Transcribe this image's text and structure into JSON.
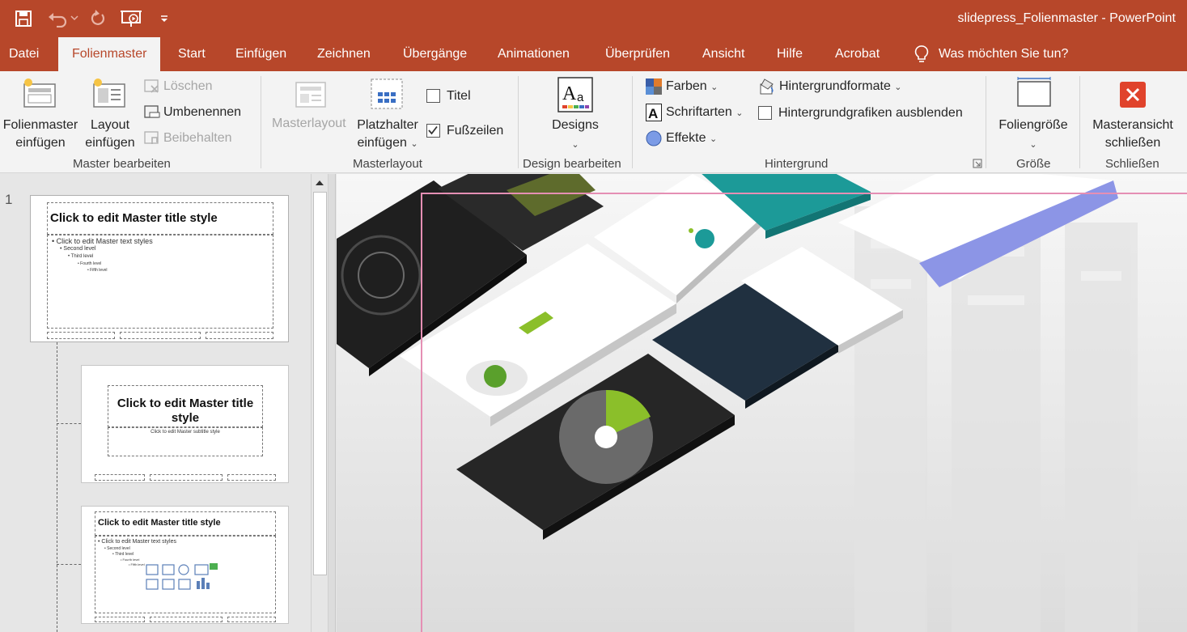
{
  "title": {
    "document": "slidepress_Folienmaster  -  PowerPoint",
    "qat_icons": [
      "save-icon",
      "undo-icon",
      "redo-icon",
      "slideshow-icon",
      "customize-qat-icon"
    ]
  },
  "tabs": [
    "Datei",
    "Folienmaster",
    "Start",
    "Einfügen",
    "Zeichnen",
    "Übergänge",
    "Animationen",
    "Überprüfen",
    "Ansicht",
    "Hilfe",
    "Acrobat"
  ],
  "active_tab": "Folienmaster",
  "tell_me": "Was möchten Sie tun?",
  "ribbon": {
    "master_bearbeiten": {
      "label": "Master bearbeiten",
      "insert_master_l1": "Folienmaster",
      "insert_master_l2": "einfügen",
      "insert_layout_l1": "Layout",
      "insert_layout_l2": "einfügen",
      "delete": "Löschen",
      "rename": "Umbenennen",
      "preserve": "Beibehalten"
    },
    "masterlayout": {
      "label": "Masterlayout",
      "master_layout": "Masterlayout",
      "placeholder_l1": "Platzhalter",
      "placeholder_l2": "einfügen",
      "title_check": "Titel",
      "footer_check": "Fußzeilen"
    },
    "design_bearbeiten": {
      "label": "Design bearbeiten",
      "designs": "Designs"
    },
    "hintergrund": {
      "label": "Hintergrund",
      "colors": "Farben",
      "fonts": "Schriftarten",
      "effects": "Effekte",
      "bg_styles": "Hintergrundformate",
      "hide_bg": "Hintergrundgrafiken ausblenden"
    },
    "groesse": {
      "label": "Größe",
      "slide_size": "Foliengröße"
    },
    "schliessen": {
      "label": "Schließen",
      "close_l1": "Masteransicht",
      "close_l2": "schließen"
    }
  },
  "thumbnails": {
    "number": "1",
    "master": {
      "title": "Click to edit Master title style",
      "levels": [
        "Click to edit Master text styles",
        "Second level",
        "Third level",
        "Fourth level",
        "Fifth level"
      ]
    },
    "title_layout": {
      "title": "Click to edit Master title style",
      "subtitle": "Click to edit Master subtitle style"
    },
    "content_layout": {
      "title": "Click to edit Master title style",
      "levels": [
        "Click to edit Master text styles",
        "Second level",
        "Third level",
        "Fourth level",
        "Fifth level"
      ]
    }
  },
  "colors": {
    "accent": "#b7472a",
    "ribbon_bg": "#f3f3f3",
    "close_red": "#e0432c",
    "slide_border": "#e58fb4",
    "green": "#8bbf2a",
    "teal": "#1c9a98",
    "lavender": "#8c95e6"
  }
}
